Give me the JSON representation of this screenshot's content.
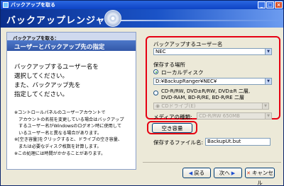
{
  "window": {
    "title": "バックアップを取る",
    "minimize_glyph": "_",
    "maximize_glyph": "□",
    "close_glyph": "×"
  },
  "banner": {
    "title": "バックアップレンジャー",
    "logo_icon": "disc-icon"
  },
  "left_panel": {
    "step_label": "バックアップを取る：",
    "step_title": "ユーザーとバックアップ先の指定",
    "instructions": [
      "バックアップするユーザー名を",
      "選択してください。",
      "また、バックアップ先を",
      "指定してください。"
    ],
    "notes": [
      "※コントロールパネルのユーザーアカウントで",
      "　アカウントの名前を変更している場合はバックアップ",
      "　するユーザー名がWindowsのログオン時に使用して",
      "　いるユーザー名と異なる場合があります。",
      "※[空き容量]をクリックすると、ドライブの空き容量、",
      "　または必要なディスク枚数を計算します。",
      "※この処理には時間がかかることがあります。"
    ]
  },
  "form": {
    "user_label": "バックアップするユーザー名",
    "user_value": "NEC",
    "location_label": "保存する場所",
    "local_disk_label": "ローカルディスク",
    "local_path": "D:¥BackupRanger¥NEC¥",
    "cd_option_line1": "CD-R/RW, DVD±R/RW, DVD±R 二層,",
    "cd_option_line2": "DVD-RAM, BD-R/RE, BD-R/RE 二層",
    "cd_drive_value": "CDドライブ(E)",
    "media_label": "メディアの種類:",
    "media_value": "CD-R/RW 650MB",
    "free_space_button": "空き容量",
    "filename_label": "保存するファイル名:",
    "filename_value": "BackupUt.but"
  },
  "nav": {
    "back": "戻る",
    "next": "次へ",
    "cancel": "キャンセル"
  },
  "colors": {
    "highlight": "#e60012",
    "banner": "#0b2f8c"
  }
}
